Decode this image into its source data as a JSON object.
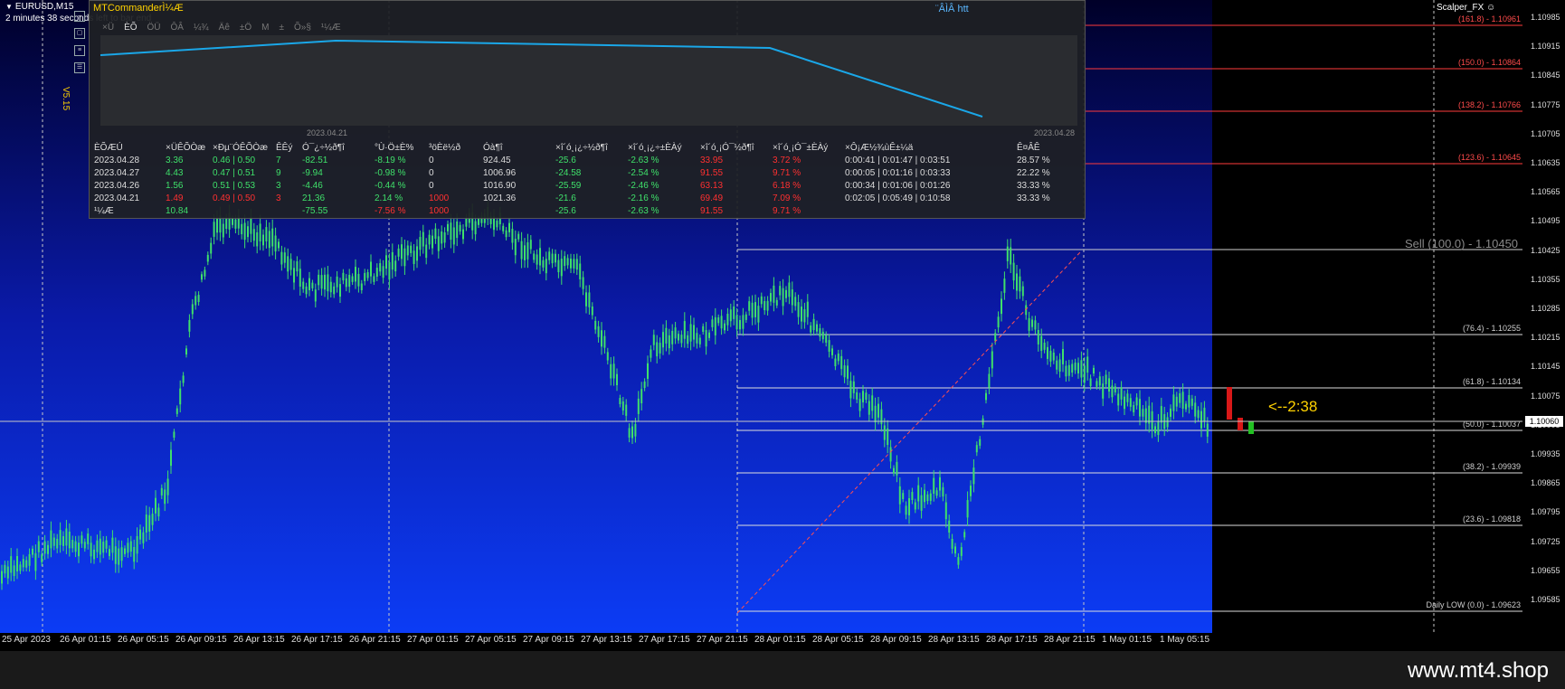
{
  "chart": {
    "symbol": "EURUSD,M15",
    "bar_end_text": "2 minutes 38 seconds left to bar end",
    "expert_name": "Scalper_FX",
    "countdown": "<--2:38",
    "sell_ghost_label": "Sell (100.0) - 1.10450",
    "current_price": "1.10060",
    "price_ticks": [
      "1.10985",
      "1.10915",
      "1.10845",
      "1.10775",
      "1.10705",
      "1.10635",
      "1.10565",
      "1.10495",
      "1.10425",
      "1.10355",
      "1.10285",
      "1.10215",
      "1.10145",
      "1.10075",
      "1.10005",
      "1.09935",
      "1.09865",
      "1.09795",
      "1.09725",
      "1.09655",
      "1.09585"
    ],
    "time_ticks": [
      "25 Apr 2023",
      "26 Apr 01:15",
      "26 Apr 05:15",
      "26 Apr 09:15",
      "26 Apr 13:15",
      "26 Apr 17:15",
      "26 Apr 21:15",
      "27 Apr 01:15",
      "27 Apr 05:15",
      "27 Apr 09:15",
      "27 Apr 13:15",
      "27 Apr 17:15",
      "27 Apr 21:15",
      "28 Apr 01:15",
      "28 Apr 05:15",
      "28 Apr 09:15",
      "28 Apr 13:15",
      "28 Apr 17:15",
      "28 Apr 21:15",
      "1 May 01:15",
      "1 May 05:15"
    ],
    "fib_levels": [
      {
        "label": "(161.8) - 1.10961",
        "color": "#ff3b3b"
      },
      {
        "label": "(150.0) - 1.10864",
        "color": "#ff3b3b"
      },
      {
        "label": "(138.2) - 1.10766",
        "color": "#ff3b3b"
      },
      {
        "label": "(123.6) - 1.10645",
        "color": "#ff3b3b"
      },
      {
        "label": "(76.4) - 1.10255",
        "color": "#dddddd"
      },
      {
        "label": "(61.8) - 1.10134",
        "color": "#dddddd"
      },
      {
        "label": "(50.0) - 1.10037",
        "color": "#dddddd"
      },
      {
        "label": "(38.2) - 1.09939",
        "color": "#dddddd"
      },
      {
        "label": "(23.6) - 1.09818",
        "color": "#dddddd"
      },
      {
        "label": "Daily LOW (0.0) - 1.09623",
        "color": "#dddddd"
      }
    ]
  },
  "panel": {
    "title": "MTCommanderÌ¼Æ",
    "link": "¨ÂÌÂ htt",
    "version": "V5.15",
    "tabs": [
      "×Ü",
      "ÈÕ",
      "ÖÜ",
      "ÔÂ",
      "¼¾",
      "Äê",
      "±Ö",
      "M",
      "±",
      "Õ»§",
      "¹¼Æ"
    ],
    "equity_dates": [
      "2023.04.21",
      "2023.04.28"
    ],
    "headers": [
      "ÈÕÆÚ",
      "×ÜÊÕÒæ",
      "×Ðµ¨ÓÊÕÒæ",
      "ÊÊý",
      "Ó¯¿÷½ð¶î",
      "°Ù·Ö±È%",
      "³öÈë½ð",
      "Óà¶î",
      "×î´ó¸¡¿÷½ð¶î",
      "×î´ó¸¡¿÷±ÈÀý",
      "×î´ó¸¡Ó¯½ð¶î",
      "×î´ó¸¡Ó¯±ÈÀý",
      "×Ô¡Æ½¾ùÊ±¼ä",
      "Ê¤ÂÊ"
    ],
    "rows": [
      {
        "date": "2023.04.28",
        "total": "3.36",
        "ratio": "0.46 | 0.50",
        "count": "7",
        "pl": "-82.51",
        "pct": "-8.19 %",
        "dep": "0",
        "bal": "924.45",
        "fl_amt": "-25.6",
        "fl_pct": "-2.63 %",
        "fp_amt": "33.95",
        "fp_pct": "3.72 %",
        "time": "0:00:41 | 0:01:47 | 0:03:51",
        "win": "28.57 %",
        "pos": true
      },
      {
        "date": "2023.04.27",
        "total": "4.43",
        "ratio": "0.47 | 0.51",
        "count": "9",
        "pl": "-9.94",
        "pct": "-0.98 %",
        "dep": "0",
        "bal": "1006.96",
        "fl_amt": "-24.58",
        "fl_pct": "-2.54 %",
        "fp_amt": "91.55",
        "fp_pct": "9.71 %",
        "time": "0:00:05 | 0:01:16 | 0:03:33",
        "win": "22.22 %",
        "pos": true
      },
      {
        "date": "2023.04.26",
        "total": "1.56",
        "ratio": "0.51 | 0.53",
        "count": "3",
        "pl": "-4.46",
        "pct": "-0.44 %",
        "dep": "0",
        "bal": "1016.90",
        "fl_amt": "-25.59",
        "fl_pct": "-2.46 %",
        "fp_amt": "63.13",
        "fp_pct": "6.18 %",
        "time": "0:00:34 | 0:01:06 | 0:01:26",
        "win": "33.33 %",
        "pos": true
      },
      {
        "date": "2023.04.21",
        "total": "1.49",
        "ratio": "0.49 | 0.50",
        "count": "3",
        "pl": "21.36",
        "pct": "2.14 %",
        "dep": "1000",
        "bal": "1021.36",
        "fl_amt": "-21.6",
        "fl_pct": "-2.16 %",
        "fp_amt": "69.49",
        "fp_pct": "7.09 %",
        "time": "0:02:05 | 0:05:49 | 0:10:58",
        "win": "33.33 %",
        "pos": false
      }
    ],
    "total_row": {
      "label": "¹¼Æ",
      "total": "10.84",
      "pl": "-75.55",
      "pct": "-7.56 %",
      "dep": "1000",
      "fl_amt": "-25.6",
      "fl_pct": "-2.63 %",
      "fp_amt": "91.55",
      "fp_pct": "9.71 %"
    }
  },
  "footer": {
    "brand": "www.mt4.shop"
  }
}
